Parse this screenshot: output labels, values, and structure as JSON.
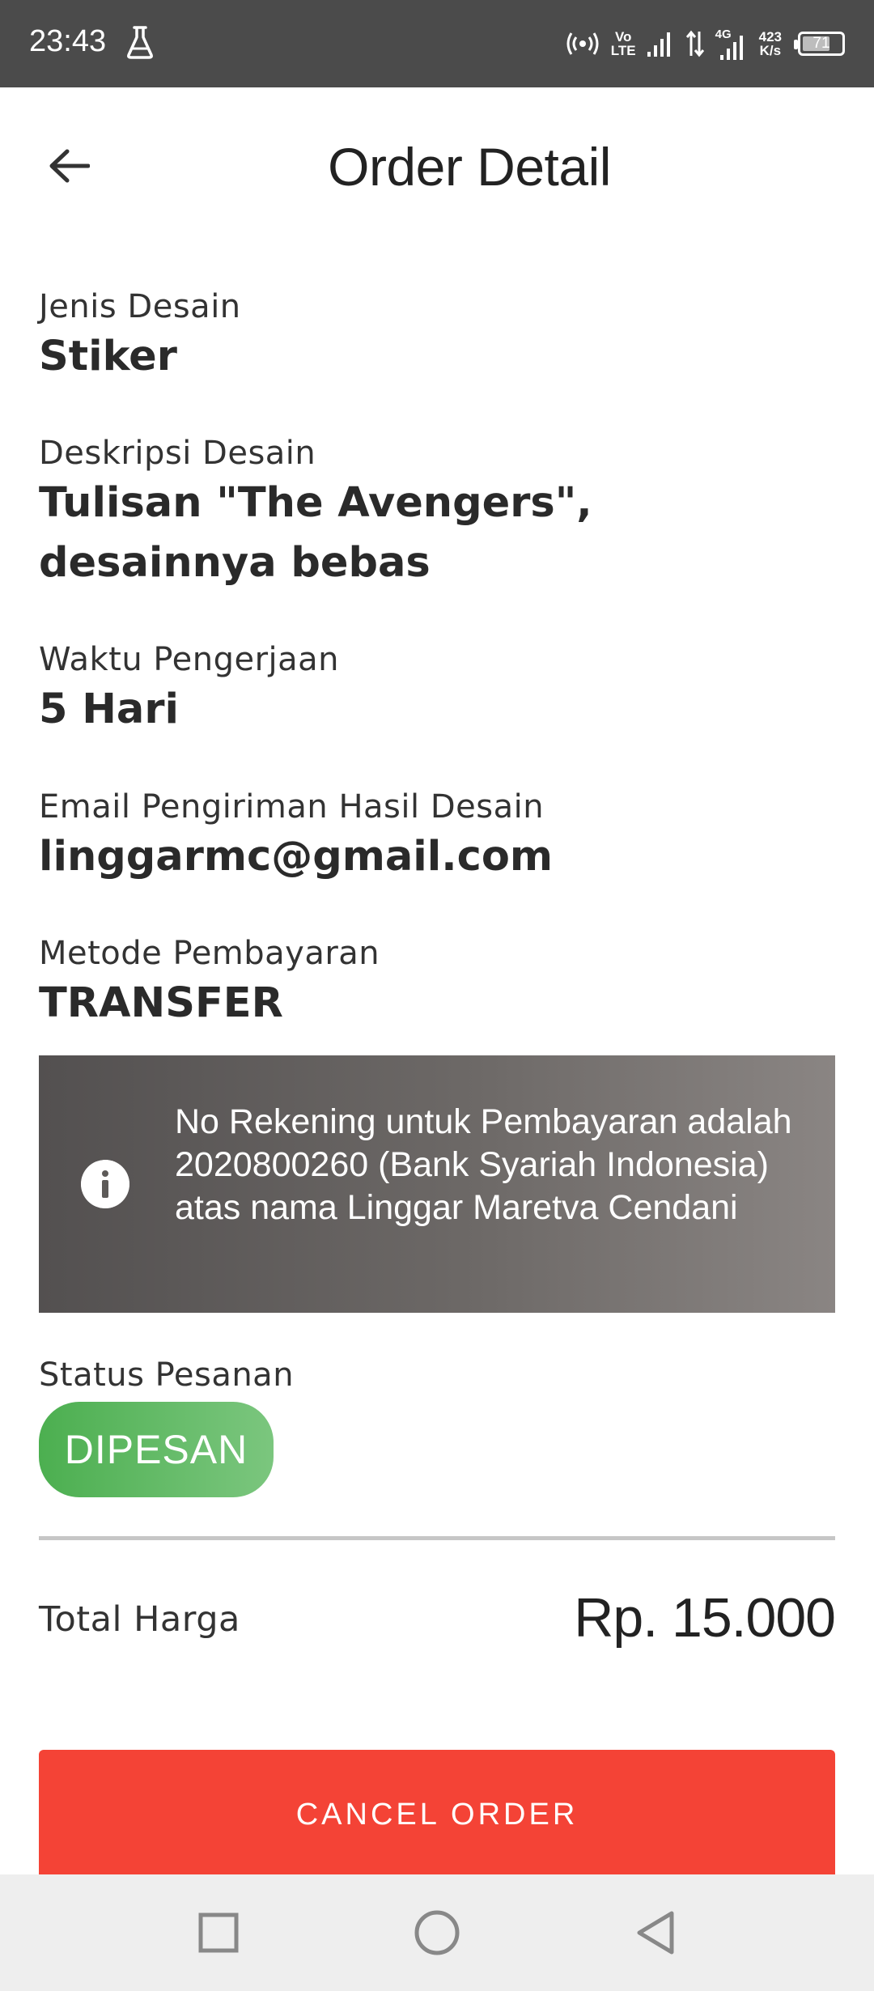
{
  "status_bar": {
    "time": "23:43",
    "hotspot_icon": "hotspot-icon",
    "volte_top": "Vo",
    "volte_bottom": "LTE",
    "network_4g": "4G",
    "speed_value": "423",
    "speed_unit": "K/s",
    "battery_level": "71",
    "battery_fraction": 0.71
  },
  "app_bar": {
    "title": "Order Detail",
    "back_icon": "arrow-left-icon"
  },
  "fields": [
    {
      "label": "Jenis Desain",
      "value": "Stiker"
    },
    {
      "label": "Deskripsi Desain",
      "value": "Tulisan \"The Avengers\", desainnya bebas"
    },
    {
      "label": "Waktu Pengerjaan",
      "value": "5 Hari"
    },
    {
      "label": "Email Pengiriman Hasil Desain",
      "value": "linggarmc@gmail.com"
    },
    {
      "label": "Metode Pembayaran",
      "value": "TRANSFER"
    }
  ],
  "info": {
    "icon": "info-icon",
    "text": "No Rekening untuk Pembayaran adalah 2020800260 (Bank Syariah Indonesia) atas nama Linggar Maretva Cendani"
  },
  "status": {
    "label": "Status Pesanan",
    "badge": "DIPESAN",
    "badge_color": "#4caf50"
  },
  "total": {
    "label": "Total Harga",
    "value": "Rp. 15.000"
  },
  "cancel_button": {
    "label": "CANCEL ORDER",
    "color": "#f44336"
  },
  "nav_bar": {
    "recents_icon": "square-icon",
    "home_icon": "circle-icon",
    "back_icon": "triangle-back-icon"
  }
}
